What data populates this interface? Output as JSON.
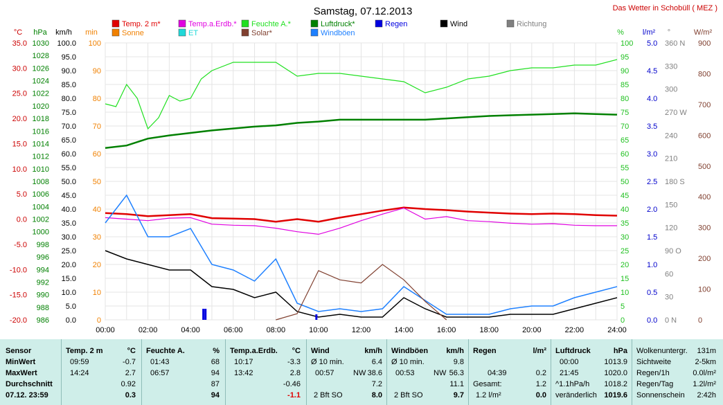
{
  "header": {
    "title": "Samstag, 07.12.2013",
    "site": "Das Wetter in Schobüll ( MEZ )"
  },
  "legend": [
    {
      "label": "Temp. 2 m*",
      "color": "#e00000"
    },
    {
      "label": "Temp.a.Erdb.*",
      "color": "#e000e0"
    },
    {
      "label": "Feuchte A.*",
      "color": "#20e020"
    },
    {
      "label": "Luftdruck*",
      "color": "#008000"
    },
    {
      "label": "Wind",
      "color": "#000000"
    },
    {
      "label": "Richtung",
      "color": "#808080"
    },
    {
      "label": "Sonne",
      "color": "#f08000"
    },
    {
      "label": "ET",
      "color": "#20d8d8"
    },
    {
      "label": "Solar*",
      "color": "#804030"
    },
    {
      "label": "Windböen",
      "color": "#1e80ff"
    },
    {
      "label": "Regen",
      "color": "#0000e0"
    }
  ],
  "axes": {
    "temp_label": "°C",
    "hpa_label": "hPa",
    "kmh_label": "km/h",
    "min_label": "min",
    "pct_label": "%",
    "lm2_label": "l/m²",
    "deg_label": "°",
    "wm2_label": "W/m²",
    "temp_ticks": [
      "35.0",
      "30.0",
      "25.0",
      "20.0",
      "15.0",
      "10.0",
      "5.0",
      "0.0",
      "-5.0",
      "-10.0",
      "-15.0",
      "-20.0"
    ],
    "hpa_ticks": [
      "1030",
      "1028",
      "1026",
      "1024",
      "1022",
      "1020",
      "1018",
      "1016",
      "1014",
      "1012",
      "1010",
      "1008",
      "1006",
      "1004",
      "1002",
      "1000",
      "998",
      "996",
      "994",
      "992",
      "990",
      "988",
      "986"
    ],
    "kmh_ticks": [
      "100.0",
      "95.0",
      "90.0",
      "85.0",
      "80.0",
      "75.0",
      "70.0",
      "65.0",
      "60.0",
      "55.0",
      "50.0",
      "45.0",
      "40.0",
      "35.0",
      "30.0",
      "25.0",
      "20.0",
      "15.0",
      "10.0",
      "5.0",
      "0.0"
    ],
    "min_ticks": [
      "100",
      "90",
      "80",
      "70",
      "60",
      "50",
      "40",
      "30",
      "20",
      "10",
      "0"
    ],
    "pct_ticks": [
      "100",
      "95",
      "90",
      "85",
      "80",
      "75",
      "70",
      "65",
      "60",
      "55",
      "50",
      "45",
      "40",
      "35",
      "30",
      "25",
      "20",
      "15",
      "10",
      "5",
      "0"
    ],
    "lm2_ticks": [
      "5.0",
      "4.5",
      "4.0",
      "3.5",
      "3.0",
      "2.5",
      "2.0",
      "1.5",
      "1.0",
      "0.5",
      "0.0"
    ],
    "deg_ticks": [
      "360 N",
      "330",
      "300",
      "270 W",
      "240",
      "210",
      "180 S",
      "150",
      "120",
      "90 O",
      "60",
      "30",
      "0 N"
    ],
    "wm2_ticks": [
      "900",
      "800",
      "700",
      "600",
      "500",
      "400",
      "300",
      "200",
      "100",
      "0"
    ],
    "time_ticks": [
      "00:00",
      "02:00",
      "04:00",
      "06:00",
      "08:00",
      "10:00",
      "12:00",
      "14:00",
      "16:00",
      "18:00",
      "20:00",
      "22:00",
      "24:00"
    ]
  },
  "chart_data": {
    "type": "line",
    "title": "Samstag, 07.12.2013",
    "x_range": [
      "00:00",
      "24:00"
    ],
    "series": [
      {
        "name": "Temp. 2 m*",
        "unit": "°C",
        "x": [
          0,
          1,
          2,
          3,
          4,
          5,
          6,
          7,
          8,
          9,
          10,
          11,
          12,
          13,
          14,
          15,
          16,
          17,
          18,
          19,
          20,
          21,
          22,
          23,
          24
        ],
        "values": [
          1.2,
          1.0,
          0.6,
          0.8,
          1.0,
          0.2,
          0.1,
          0.0,
          -0.5,
          0.0,
          -0.5,
          0.3,
          1.0,
          1.7,
          2.3,
          2.0,
          1.8,
          1.5,
          1.3,
          1.1,
          1.0,
          1.1,
          1.0,
          0.8,
          0.7
        ]
      },
      {
        "name": "Temp.a.Erdb.*",
        "unit": "°C",
        "x": [
          0,
          1,
          2,
          3,
          4,
          5,
          6,
          7,
          8,
          9,
          10,
          11,
          12,
          13,
          14,
          15,
          16,
          17,
          18,
          19,
          20,
          21,
          22,
          23,
          24
        ],
        "values": [
          0.3,
          0.0,
          -0.3,
          0.2,
          0.3,
          -1.0,
          -1.2,
          -1.3,
          -1.8,
          -2.5,
          -3.0,
          -1.8,
          -0.3,
          1.0,
          2.2,
          0.0,
          0.5,
          -0.3,
          -0.5,
          -0.8,
          -1.0,
          -0.9,
          -1.2,
          -1.3,
          -1.3
        ]
      },
      {
        "name": "Feuchte A.*",
        "unit": "%",
        "x": [
          0,
          0.5,
          1,
          1.5,
          2,
          2.5,
          3,
          3.5,
          4,
          4.5,
          5,
          6,
          7,
          8,
          9,
          10,
          11,
          12,
          13,
          14,
          15,
          16,
          17,
          18,
          19,
          20,
          21,
          22,
          23,
          24
        ],
        "values": [
          78,
          77,
          85,
          80,
          69,
          73,
          81,
          79,
          80,
          87,
          90,
          93,
          93,
          93,
          88,
          89,
          89,
          88,
          87,
          86,
          82,
          84,
          87,
          88,
          90,
          91,
          91,
          92,
          92,
          94
        ]
      },
      {
        "name": "Luftdruck*",
        "unit": "hPa",
        "x": [
          0,
          1,
          2,
          3,
          4,
          5,
          6,
          7,
          8,
          9,
          10,
          11,
          12,
          13,
          14,
          15,
          16,
          17,
          18,
          19,
          20,
          21,
          22,
          23,
          24
        ],
        "values": [
          1013.3,
          1013.7,
          1014.8,
          1015.3,
          1015.7,
          1016.1,
          1016.4,
          1016.7,
          1016.9,
          1017.3,
          1017.5,
          1017.8,
          1017.8,
          1017.8,
          1017.8,
          1017.8,
          1018.0,
          1018.2,
          1018.4,
          1018.5,
          1018.6,
          1018.7,
          1018.8,
          1018.7,
          1018.6
        ]
      },
      {
        "name": "Wind",
        "unit": "km/h",
        "x": [
          0,
          1,
          2,
          3,
          4,
          5,
          6,
          7,
          8,
          9,
          10,
          11,
          12,
          13,
          14,
          15,
          16,
          17,
          18,
          19,
          20,
          21,
          22,
          23,
          24
        ],
        "values": [
          25,
          22,
          20,
          18,
          18,
          12,
          11,
          8,
          10,
          3,
          1,
          2,
          1,
          1,
          8,
          4,
          1,
          1,
          1,
          2,
          2,
          2,
          4,
          6,
          8
        ]
      },
      {
        "name": "Windböen",
        "unit": "km/h",
        "x": [
          0,
          1,
          2,
          3,
          4,
          5,
          6,
          7,
          8,
          9,
          10,
          11,
          12,
          13,
          14,
          15,
          16,
          17,
          18,
          19,
          20,
          21,
          22,
          23,
          24
        ],
        "values": [
          35,
          45,
          30,
          30,
          33,
          20,
          18,
          14,
          22,
          6,
          3,
          4,
          3,
          4,
          12,
          7,
          2,
          2,
          2,
          4,
          5,
          5,
          8,
          10,
          12
        ]
      },
      {
        "name": "Solar*",
        "unit": "W/m²",
        "x": [
          8,
          9,
          10,
          11,
          12,
          13,
          14,
          15,
          16
        ],
        "values": [
          0,
          20,
          160,
          130,
          120,
          180,
          130,
          60,
          0
        ]
      },
      {
        "name": "Regen",
        "unit": "l/m²",
        "x": [
          4.6,
          4.7,
          9.9
        ],
        "values": [
          0.2,
          0.2,
          0.1
        ]
      }
    ],
    "ylim": {
      "temp": [
        -20,
        35
      ],
      "pressure": [
        986,
        1030
      ],
      "wind": [
        0,
        100
      ],
      "humidity": [
        0,
        100
      ],
      "rain": [
        0,
        5
      ],
      "solar": [
        0,
        900
      ]
    }
  },
  "panel": {
    "sensor": {
      "header": "Sensor",
      "min": "MinWert",
      "max": "MaxWert",
      "avg": "Durchschnitt",
      "current": "07.12. 23:59"
    },
    "temp2m": {
      "header": "Temp. 2 m",
      "unit": "°C",
      "min_time": "09:59",
      "min_val": "-0.7",
      "max_time": "14:24",
      "max_val": "2.7",
      "avg": "0.92",
      "current": "0.3"
    },
    "feuchte": {
      "header": "Feuchte A.",
      "unit": "%",
      "min_time": "01:43",
      "min_val": "68",
      "max_time": "06:57",
      "max_val": "94",
      "avg": "87",
      "current": "94"
    },
    "erdb": {
      "header": "Temp.a.Erdb.",
      "unit": "°C",
      "min_time": "10:17",
      "min_val": "-3.3",
      "max_time": "13:42",
      "max_val": "2.8",
      "avg": "-0.46",
      "current": "-1.1"
    },
    "wind": {
      "header": "Wind",
      "unit": "km/h",
      "row1_label": "Ø 10 min.",
      "row1_val": "6.4",
      "max_time": "00:57",
      "max_dir": "NW",
      "max_val": "38.6",
      "avg": "7.2",
      "current_label": "2 Bft SO",
      "current": "8.0"
    },
    "boeen": {
      "header": "Windböen",
      "unit": "km/h",
      "row1_label": "Ø 10 min.",
      "row1_val": "9.8",
      "max_time": "00:53",
      "max_dir": "NW",
      "max_val": "56.3",
      "avg": "11.1",
      "current_label": "2 Bft SO",
      "current": "9.7"
    },
    "regen": {
      "header": "Regen",
      "unit": "l/m²",
      "max_time": "04:39",
      "max_val": "0.2",
      "total_label": "Gesamt:",
      "total_val": "1.2",
      "current_label": "1.2 l/m²",
      "current": "0.0"
    },
    "luftdruck": {
      "header": "Luftdruck",
      "unit": "hPa",
      "min_time": "00:00",
      "min_val": "1013.9",
      "max_time": "21:45",
      "max_val": "1020.0",
      "trend_label": "^1.1hPa/h",
      "avg": "1018.2",
      "current_label": "veränderlich",
      "current": "1019.6"
    },
    "misc": {
      "r1_label": "Wolkenuntergr.",
      "r1_val": "131m",
      "r2_label": "Sichtweite",
      "r2_val": "2-5km",
      "r3_label": "Regen/1h",
      "r3_val": "0.0l/m²",
      "r4_label": "Regen/Tag",
      "r4_val": "1.2l/m²",
      "r5_label": "Sonnenschein",
      "r5_val": "2:42h"
    }
  }
}
